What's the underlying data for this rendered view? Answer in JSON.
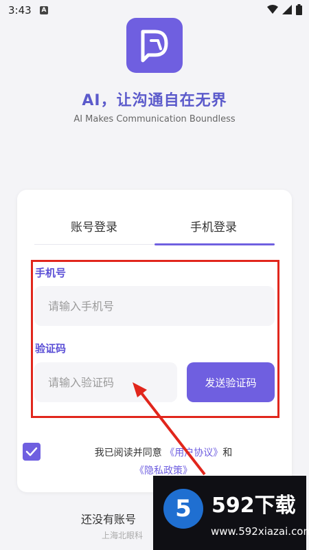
{
  "status_bar": {
    "time": "3:43",
    "notification_letter": "A"
  },
  "hero": {
    "slogan_cn": "AI，让沟通自在无界",
    "slogan_en": "AI Makes Communication Boundless"
  },
  "tabs": [
    {
      "label": "账号登录",
      "active": false
    },
    {
      "label": "手机登录",
      "active": true
    }
  ],
  "phone": {
    "label": "手机号",
    "placeholder": "请输入手机号"
  },
  "code": {
    "label": "验证码",
    "placeholder": "请输入验证码",
    "send_button": "发送验证码"
  },
  "agreement": {
    "prefix": "我已阅读并同意 ",
    "user_agreement": "《用户协议》",
    "and": "和",
    "privacy_policy": "《隐私政策》",
    "checked": true
  },
  "footer": {
    "text": "还没有账号",
    "company": "上海北眼科"
  },
  "watermark": {
    "badge": "5",
    "title": "592下载",
    "url": "www.592xiazai.com"
  },
  "colors": {
    "accent": "#6f5fe0",
    "highlight_box": "#e1261c",
    "background": "#f4f4f7"
  }
}
